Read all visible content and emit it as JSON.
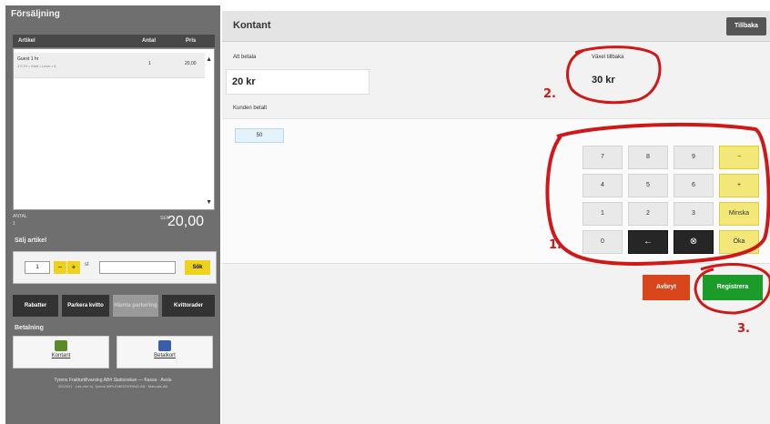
{
  "sidebar": {
    "title": "Försäljning",
    "cart_headers": {
      "article": "Artikel",
      "qty": "Antal",
      "price": "Pris"
    },
    "cart_items": [
      {
        "name": "Guest 1 hr",
        "detail": "3 KTH • Start • Lewe • A",
        "qty": "1",
        "price": "20,00"
      }
    ],
    "total": {
      "label": "ANTAL",
      "sub": "1",
      "unit": "SEK",
      "amount": "20,00"
    },
    "sell": {
      "label": "Sälj artikel",
      "qty": "1",
      "minus": "−",
      "plus": "+",
      "x_label": "st",
      "code_placeholder": "",
      "go": "Sök"
    },
    "actions": [
      {
        "label": "Rabatter",
        "enabled": true
      },
      {
        "label": "Parkera kvitto",
        "enabled": true
      },
      {
        "label": "Hämta parkering",
        "enabled": false
      },
      {
        "label": "Kvittorader",
        "enabled": true
      }
    ],
    "payment": {
      "label": "Betalning",
      "options": [
        {
          "label": "Kontant",
          "icon": "cash-icon",
          "color": "#5a8a2a"
        },
        {
          "label": "Betalkort",
          "icon": "card-icon",
          "color": "#3a5fa8"
        }
      ]
    },
    "footer": [
      "Tyrens Frakturtillvarsing AB4 Stationskan — Kassa · Avslu",
      "2022021 · Läs mer hj. Tyrens IMPLEMENTERING AB · Manuals AB"
    ]
  },
  "cash": {
    "title": "Kontant",
    "back": "Tillbaka",
    "to_pay_label": "Att betala",
    "to_pay": "20 kr",
    "change_label": "Växel tillbaka",
    "change": "30 kr",
    "paid_label": "Kunden betalt",
    "paid_value": "50",
    "keypad": [
      [
        "7",
        "8",
        "9",
        "−"
      ],
      [
        "4",
        "5",
        "6",
        "+"
      ],
      [
        "1",
        "2",
        "3",
        "Minska"
      ],
      [
        "0",
        "←",
        "⊗",
        "Öka"
      ]
    ],
    "cancel": "Avbryt",
    "register": "Registrera"
  },
  "annotations": [
    "1.",
    "2.",
    "3."
  ],
  "colors": {
    "register": "#1b9b2a",
    "cancel": "#d9461c",
    "accent": "#f0d21a",
    "annotation": "#cc1a1a"
  }
}
